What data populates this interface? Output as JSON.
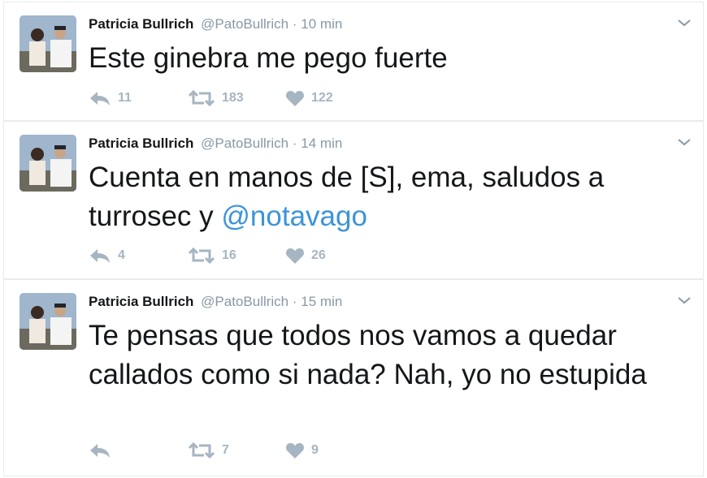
{
  "colors": {
    "name": "#14171a",
    "meta": "#8899a6",
    "link": "#3b94d9",
    "action": "#a6b5c2",
    "border": "#e6ecf0"
  },
  "tweets": [
    {
      "fullname": "Patricia Bullrich",
      "username": "@PatoBullrich",
      "dot": "·",
      "time": "10 min",
      "text": "Este ginebra me pego fuerte",
      "mention": "",
      "replies": "11",
      "retweets": "183",
      "likes": "122"
    },
    {
      "fullname": "Patricia Bullrich",
      "username": "@PatoBullrich",
      "dot": "·",
      "time": "14 min",
      "text": "Cuenta en manos de [S], ema, saludos a turrosec y ",
      "mention": "@notavago",
      "replies": "4",
      "retweets": "16",
      "likes": "26"
    },
    {
      "fullname": "Patricia Bullrich",
      "username": "@PatoBullrich",
      "dot": "·",
      "time": "15 min",
      "text": "Te pensas que todos nos vamos a quedar callados como si nada? Nah, yo no estupida",
      "mention": "",
      "replies": "",
      "retweets": "7",
      "likes": "9"
    }
  ],
  "icons": {
    "avatar": "profile-photo",
    "more": "chevron-down-icon",
    "reply": "reply-icon",
    "retweet": "retweet-icon",
    "like": "heart-icon"
  }
}
